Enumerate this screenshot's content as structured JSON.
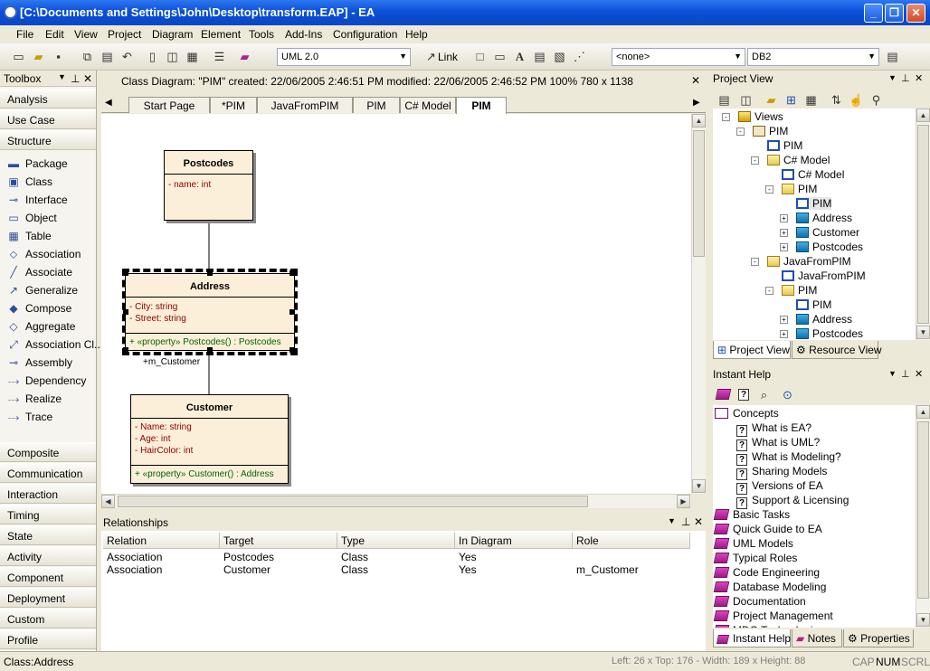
{
  "window": {
    "title": "[C:\\Documents and Settings\\John\\Desktop\\transform.EAP] - EA"
  },
  "menu": [
    "File",
    "Edit",
    "View",
    "Project",
    "Diagram",
    "Element",
    "Tools",
    "Add-Ins",
    "Configuration",
    "Help"
  ],
  "toolbar": {
    "uml_combo": "UML 2.0",
    "link_label": "Link",
    "none_combo": "<none>",
    "db_combo": "DB2"
  },
  "toolbox": {
    "title": "Toolbox",
    "top_categories": [
      "Analysis",
      "Use Case",
      "Structure"
    ],
    "structure_items": [
      {
        "label": "Package",
        "icon": "package-icon"
      },
      {
        "label": "Class",
        "icon": "class-icon"
      },
      {
        "label": "Interface",
        "icon": "interface-icon"
      },
      {
        "label": "Object",
        "icon": "object-icon"
      },
      {
        "label": "Table",
        "icon": "table-icon"
      },
      {
        "label": "Association",
        "icon": "association-icon"
      },
      {
        "label": "Associate",
        "icon": "associate-icon"
      },
      {
        "label": "Generalize",
        "icon": "generalize-icon"
      },
      {
        "label": "Compose",
        "icon": "compose-icon"
      },
      {
        "label": "Aggregate",
        "icon": "aggregate-icon"
      },
      {
        "label": "Association Cl...",
        "icon": "association-class-icon"
      },
      {
        "label": "Assembly",
        "icon": "assembly-icon"
      },
      {
        "label": "Dependency",
        "icon": "dependency-icon"
      },
      {
        "label": "Realize",
        "icon": "realize-icon"
      },
      {
        "label": "Trace",
        "icon": "trace-icon"
      }
    ],
    "bottom_categories": [
      "Composite",
      "Communication",
      "Interaction",
      "Timing",
      "State",
      "Activity",
      "Component",
      "Deployment",
      "Custom",
      "Profile"
    ]
  },
  "diagram": {
    "info": "Class Diagram: \"PIM\"  created: 22/06/2005 2:46:51 PM  modified: 22/06/2005 2:46:52 PM   100%   780 x 1138",
    "tabs": [
      "Start Page",
      "*PIM",
      "JavaFromPIM",
      "PIM",
      "C# Model",
      "PIM"
    ],
    "active_tab": "PIM",
    "classes": {
      "postcodes": {
        "name": "Postcodes",
        "attrs": [
          "-     name:  int"
        ]
      },
      "address": {
        "name": "Address",
        "attrs": [
          "-     City:  string",
          "-     Street:  string"
        ],
        "ops": [
          "+     «property» Postcodes() : Postcodes"
        ]
      },
      "customer": {
        "name": "Customer",
        "attrs": [
          "-     Name:  string",
          "-     Age:  int",
          "-     HairColor:  int"
        ],
        "ops": [
          "+     «property» Customer() : Address"
        ]
      }
    },
    "role_label": "+m_Customer"
  },
  "relationships": {
    "title": "Relationships",
    "columns": [
      "Relation",
      "Target",
      "Type",
      "In Diagram",
      "Role"
    ],
    "rows": [
      [
        "Association",
        "Postcodes",
        "Class",
        "Yes",
        ""
      ],
      [
        "Association",
        "Customer",
        "Class",
        "Yes",
        "m_Customer"
      ]
    ]
  },
  "project_view": {
    "title": "Project View",
    "tree": [
      {
        "label": "Views",
        "icon": "views-icon",
        "exp": "-"
      },
      {
        "label": "PIM",
        "icon": "package-icon",
        "exp": "-"
      },
      {
        "label": "PIM",
        "icon": "diagram-icon"
      },
      {
        "label": "C# Model",
        "icon": "folder-icon",
        "exp": "-"
      },
      {
        "label": "C# Model",
        "icon": "diagram-icon"
      },
      {
        "label": "PIM",
        "icon": "folder-icon",
        "exp": "-"
      },
      {
        "label": "PIM",
        "icon": "diagram-icon"
      },
      {
        "label": "Address",
        "icon": "class-icon",
        "exp": "+"
      },
      {
        "label": "Customer",
        "icon": "class-icon",
        "exp": "+"
      },
      {
        "label": "Postcodes",
        "icon": "class-icon",
        "exp": "+"
      },
      {
        "label": "JavaFromPIM",
        "icon": "folder-icon",
        "exp": "-"
      },
      {
        "label": "JavaFromPIM",
        "icon": "diagram-icon"
      },
      {
        "label": "PIM",
        "icon": "folder-icon",
        "exp": "-"
      },
      {
        "label": "PIM",
        "icon": "diagram-icon"
      },
      {
        "label": "Address",
        "icon": "class-icon",
        "exp": "+"
      },
      {
        "label": "Postcodes",
        "icon": "class-icon",
        "exp": "+"
      }
    ],
    "tabs": [
      "Project View",
      "Resource View"
    ]
  },
  "instant_help": {
    "title": "Instant Help",
    "items": [
      {
        "label": "Concepts",
        "kind": "open-book"
      },
      {
        "label": "What is EA?",
        "kind": "topic"
      },
      {
        "label": "What is UML?",
        "kind": "topic"
      },
      {
        "label": "What is Modeling?",
        "kind": "topic"
      },
      {
        "label": "Sharing Models",
        "kind": "topic"
      },
      {
        "label": "Versions of EA",
        "kind": "topic"
      },
      {
        "label": "Support & Licensing",
        "kind": "topic"
      },
      {
        "label": "Basic Tasks",
        "kind": "book"
      },
      {
        "label": "Quick Guide to EA",
        "kind": "book"
      },
      {
        "label": "UML Models",
        "kind": "book"
      },
      {
        "label": "Typical Roles",
        "kind": "book"
      },
      {
        "label": "Code Engineering",
        "kind": "book"
      },
      {
        "label": "Database Modeling",
        "kind": "book"
      },
      {
        "label": "Documentation",
        "kind": "book"
      },
      {
        "label": "Project Management",
        "kind": "book"
      },
      {
        "label": "MDG Technologies",
        "kind": "book"
      }
    ],
    "tabs": [
      "Instant Help",
      "Notes",
      "Properties"
    ]
  },
  "status": {
    "left": "Class:Address",
    "position": "Left:   26 x Top:  176 - Width:  189 x Height:   88",
    "caps": "CAP",
    "num": "NUM",
    "scrl": "SCRL"
  }
}
